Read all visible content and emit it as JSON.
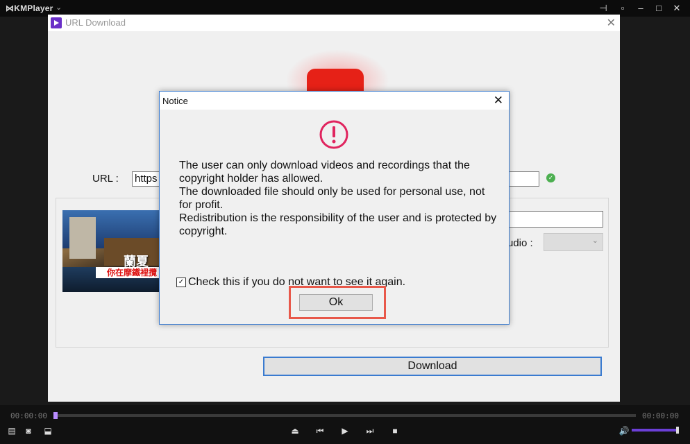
{
  "player": {
    "app_name": "KMPlayer",
    "time_elapsed": "00:00:00",
    "time_total": "00:00:00"
  },
  "url_download": {
    "title": "URL Download",
    "url_label": "URL :",
    "url_value": "https",
    "audio_label": "udio :",
    "thumb_caption_1": "蘭夏",
    "thumb_caption_2": "你在摩鐵裡攬",
    "download_label": "Download"
  },
  "notice": {
    "title": "Notice",
    "message_lines": [
      "The user can only download videos and recordings that the copyright holder has allowed.",
      "The downloaded file should only be used for personal use, not for profit.",
      "Redistribution is the responsibility of the user and is protected by copyright."
    ],
    "checkbox_label": "Check this if you do not want to see it again.",
    "checkbox_checked": true,
    "ok_label": "Ok"
  },
  "icons": {
    "warning": "exclamation-circle-icon",
    "close": "close-icon",
    "check": "check-circle-icon"
  },
  "colors": {
    "accent_blue": "#3a7bd0",
    "warning_red": "#e0245e",
    "highlight_red": "#e8584a",
    "youtube_red": "#e62117",
    "volume_purple": "#6b3fd6"
  }
}
